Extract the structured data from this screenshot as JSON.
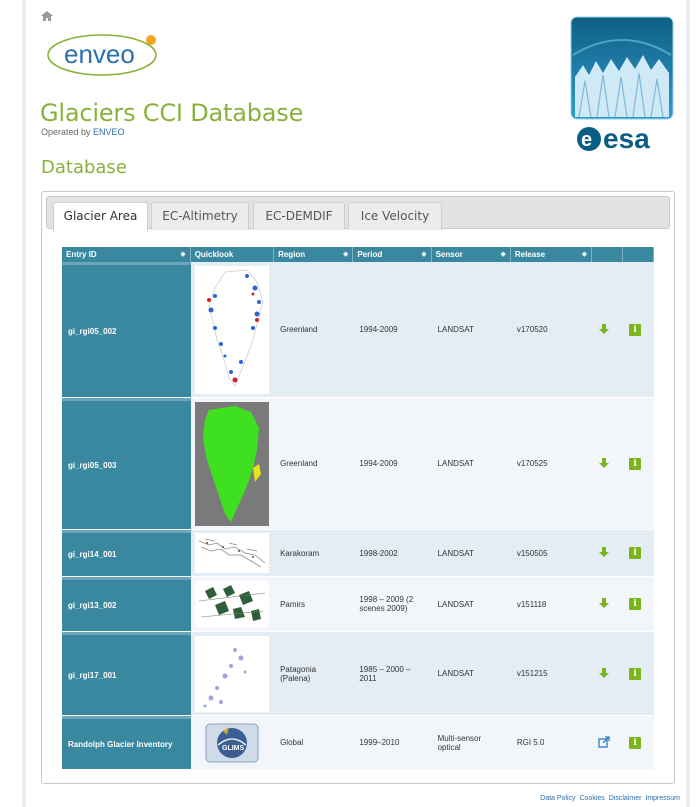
{
  "header": {
    "logo_text": "enveo",
    "site_title": "Glaciers CCI Database",
    "operated_by_prefix": "Operated by",
    "operated_by_link": "ENVEO",
    "esa_text": "esa"
  },
  "section_title": "Database",
  "tabs": [
    {
      "label": "Glacier Area",
      "active": true
    },
    {
      "label": "EC-Altimetry",
      "active": false
    },
    {
      "label": "EC-DEMDIF",
      "active": false
    },
    {
      "label": "Ice Velocity",
      "active": false
    }
  ],
  "table": {
    "columns": [
      "Entry ID",
      "Quicklook",
      "Region",
      "Period",
      "Sensor",
      "Release",
      "",
      ""
    ],
    "rows": [
      {
        "entry_id": "gi_rgi05_002",
        "region": "Greenland",
        "period": "1994-2009",
        "sensor": "LANDSAT",
        "release": "v170520",
        "action_icon": "download-icon"
      },
      {
        "entry_id": "gi_rgi05_003",
        "region": "Greenland",
        "period": "1994-2009",
        "sensor": "LANDSAT",
        "release": "v170525",
        "action_icon": "download-icon"
      },
      {
        "entry_id": "gi_rgi14_001",
        "region": "Karakoram",
        "period": "1998-2002",
        "sensor": "LANDSAT",
        "release": "v150505",
        "action_icon": "download-icon"
      },
      {
        "entry_id": "gi_rgi13_002",
        "region": "Pamirs",
        "period": "1998 – 2009 (2 scenes 2009)",
        "sensor": "LANDSAT",
        "release": "v151118",
        "action_icon": "download-icon"
      },
      {
        "entry_id": "gi_rgi17_001",
        "region": "Patagonia (Palena)",
        "period": "1985 – 2000 – 2011",
        "sensor": "LANDSAT",
        "release": "v151215",
        "action_icon": "download-icon"
      },
      {
        "entry_id": "Randolph Glacier Inventory",
        "region": "Global",
        "period": "1999–2010",
        "sensor": "Multi-sensor optical",
        "release": "RGI 5.0",
        "action_icon": "external-link-icon"
      }
    ],
    "glims_label": "GLIMS"
  },
  "footer": {
    "links": [
      "Data Policy",
      "Cookies",
      "Disclaimer",
      "Impressum"
    ]
  },
  "colors": {
    "title_green": "#8ab13d",
    "table_header": "#3a88a0",
    "link_blue": "#2a6fae",
    "info_green": "#7ab51d"
  }
}
